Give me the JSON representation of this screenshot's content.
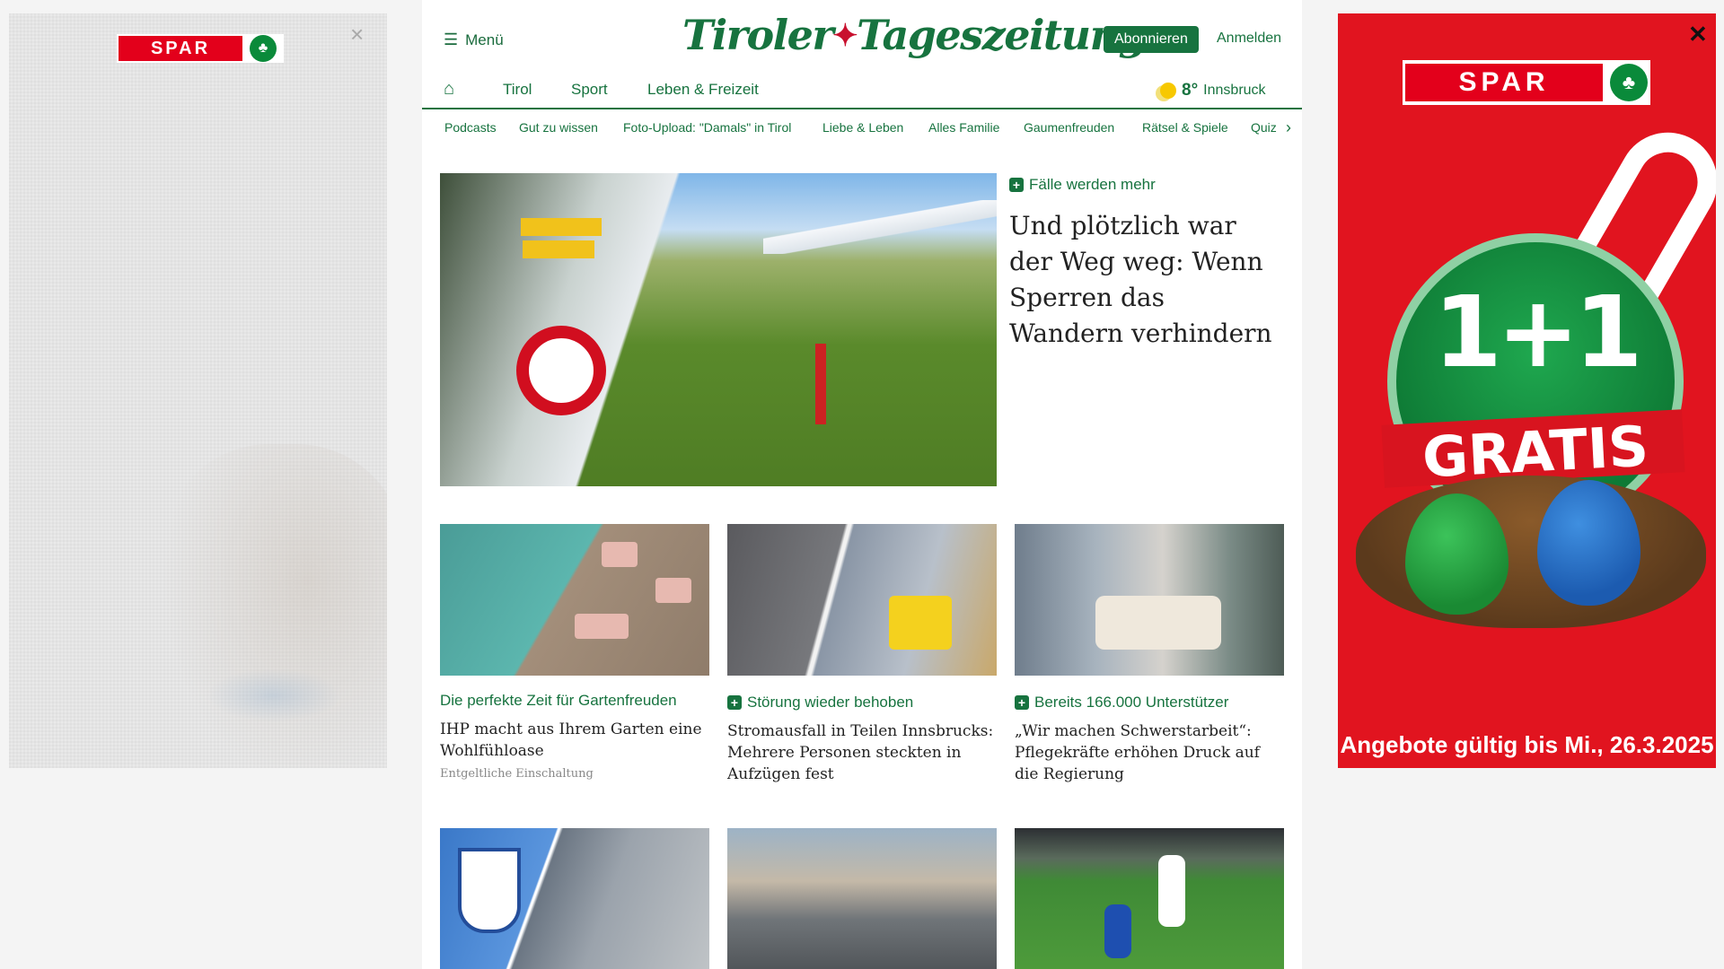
{
  "left_ad": {
    "brand": "SPAR",
    "close_label": "×"
  },
  "header": {
    "menu_label": "Menü",
    "logo_left": "Tiroler",
    "logo_right": "Tageszeitung",
    "subscribe_label": "Abonnieren",
    "login_label": "Anmelden"
  },
  "nav": {
    "home_icon": "home-icon",
    "items": [
      "Tirol",
      "Sport",
      "Leben & Freizeit"
    ],
    "weather": {
      "temp": "8°",
      "city": "Innsbruck"
    }
  },
  "subnav": {
    "items": [
      "Podcasts",
      "Gut zu wissen",
      "Foto-Upload: \"Damals\" in Tirol",
      "Liebe & Leben",
      "Alles Familie",
      "Gaumenfreuden",
      "Rätsel & Spiele",
      "Quiz"
    ],
    "arrow": "›"
  },
  "hero": {
    "kicker": "Fälle werden mehr",
    "title": "Und plötzlich war der Weg weg: Wenn Sperren das Wandern verhindern"
  },
  "cards": [
    {
      "kicker": "Die perfekte Zeit für Gartenfreuden",
      "premium": false,
      "title": "IHP macht aus Ihrem Garten eine Wohlfühloase",
      "note": "Entgeltliche Einschaltung"
    },
    {
      "kicker": "Störung wieder behoben",
      "premium": true,
      "title": "Stromausfall in Teilen Innsbrucks: Mehrere Personen steckten in Aufzügen fest",
      "note": ""
    },
    {
      "kicker": "Bereits 166.000 Unterstützer",
      "premium": true,
      "title": "„Wir machen Schwerstarbeit“: Pflegekräfte erhöhen Druck auf die Regierung",
      "note": ""
    }
  ],
  "right_ad": {
    "brand": "SPAR",
    "offer": "1+1",
    "offer_word": "GRATIS",
    "validity": "Angebote gültig bis Mi., 26.3.2025",
    "close_label": "✕"
  },
  "colors": {
    "brand_green": "#17733f",
    "spar_red": "#e1141f"
  }
}
